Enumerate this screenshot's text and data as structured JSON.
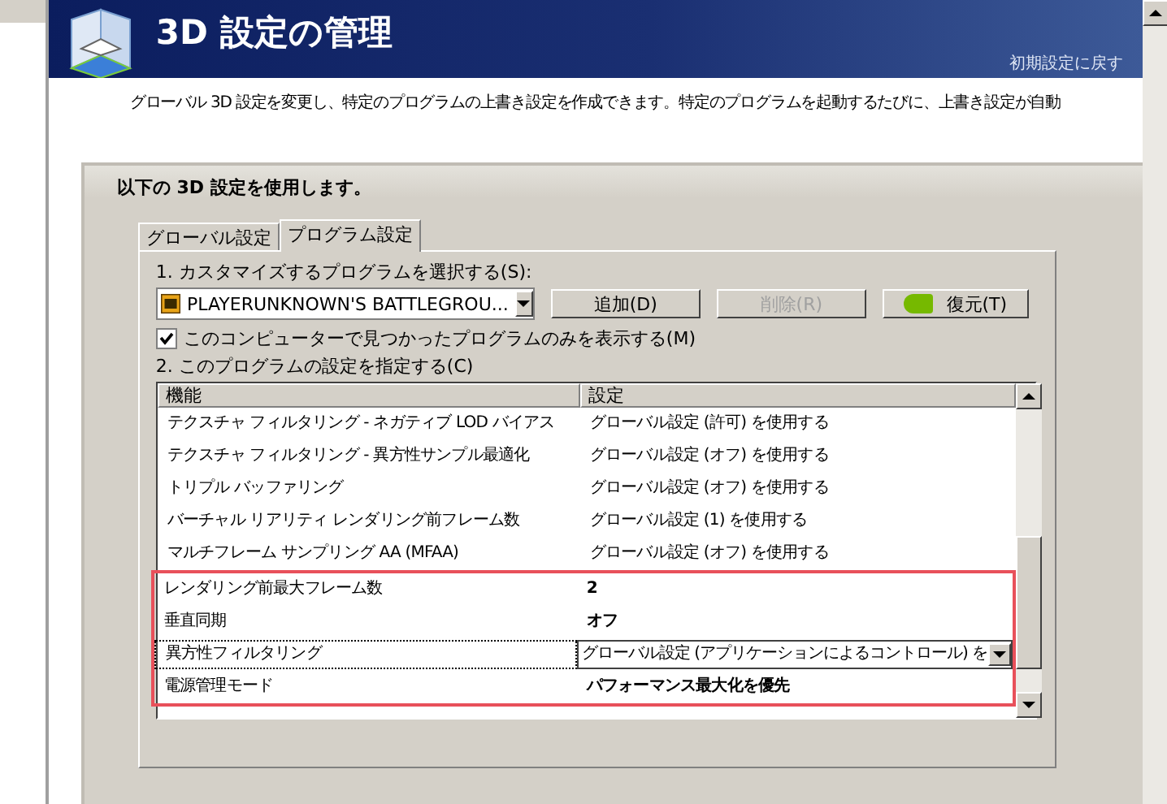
{
  "header": {
    "title": "3D 設定の管理",
    "restore_link": "初期設定に戻す"
  },
  "description": "グローバル 3D 設定を変更し、特定のプログラムの上書き設定を作成できます。特定のプログラムを起動するたびに、上書き設定が自動",
  "panel": {
    "title": "以下の 3D 設定を使用します。",
    "tabs": [
      {
        "label": "グローバル設定",
        "selected": false
      },
      {
        "label": "プログラム設定",
        "selected": true
      }
    ],
    "step1_label": "1. カスタマイズするプログラムを選択する(S):",
    "program_select": {
      "value": "PLAYERUNKNOWN'S BATTLEGROU..."
    },
    "buttons": [
      {
        "label": "追加(D)",
        "disabled": false,
        "icon": false
      },
      {
        "label": "削除(R)",
        "disabled": true,
        "icon": false
      },
      {
        "label": "復元(T)",
        "disabled": false,
        "icon": true
      }
    ],
    "filter_checkbox": {
      "label": "このコンピューターで見つかったプログラムのみを表示する(M)",
      "checked": true
    },
    "step2_label": "2. このプログラムの設定を指定する(C)",
    "table": {
      "columns": [
        "機能",
        "設定"
      ],
      "rows": [
        {
          "feature": "テクスチャ フィルタリング - ネガティブ LOD バイアス",
          "setting": "グローバル設定 (許可) を使用する",
          "kind": "default",
          "highlighted": false,
          "focused": false
        },
        {
          "feature": "テクスチャ フィルタリング - 異方性サンプル最適化",
          "setting": "グローバル設定 (オフ) を使用する",
          "kind": "default",
          "highlighted": false,
          "focused": false
        },
        {
          "feature": "トリプル バッファリング",
          "setting": "グローバル設定 (オフ) を使用する",
          "kind": "default",
          "highlighted": false,
          "focused": false
        },
        {
          "feature": "バーチャル リアリティ レンダリング前フレーム数",
          "setting": "グローバル設定 (1) を使用する",
          "kind": "default",
          "highlighted": false,
          "focused": false
        },
        {
          "feature": "マルチフレーム サンプリング AA (MFAA)",
          "setting": "グローバル設定 (オフ) を使用する",
          "kind": "default",
          "highlighted": false,
          "focused": false
        },
        {
          "feature": "レンダリング前最大フレーム数",
          "setting": "2",
          "kind": "custom",
          "highlighted": true,
          "focused": false
        },
        {
          "feature": "垂直同期",
          "setting": "オフ",
          "kind": "custom",
          "highlighted": true,
          "focused": false
        },
        {
          "feature": "異方性フィルタリング",
          "setting": "グローバル設定 (アプリケーションによるコントロール) を",
          "kind": "dropdown",
          "highlighted": true,
          "focused": true
        },
        {
          "feature": "電源管理モード",
          "setting": "パフォーマンス最大化を優先",
          "kind": "custom",
          "highlighted": true,
          "focused": false
        }
      ]
    }
  }
}
